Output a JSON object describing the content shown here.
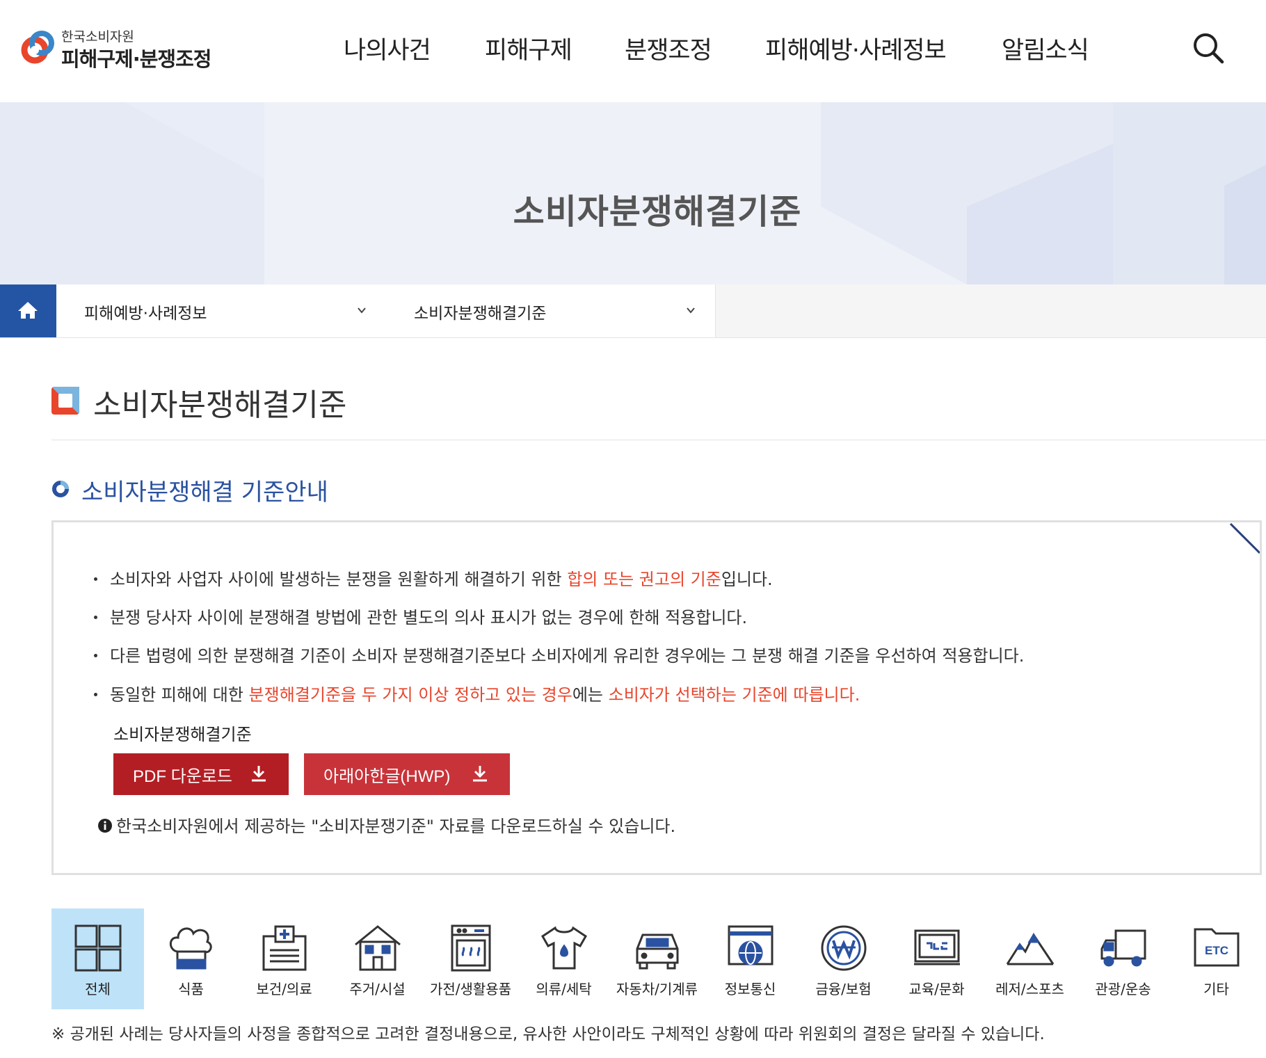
{
  "header": {
    "logo_sub": "한국소비자원",
    "logo_main": "피해구제·분쟁조정",
    "nav": [
      "나의사건",
      "피해구제",
      "분쟁조정",
      "피해예방·사례정보",
      "알림소식"
    ],
    "search_icon": "search-icon"
  },
  "banner": {
    "title": "소비자분쟁해결기준"
  },
  "breadcrumb": {
    "home_icon": "home-icon",
    "level1": "피해예방·사례정보",
    "level2": "소비자분쟁해결기준"
  },
  "page_title": "소비자분쟁해결기준",
  "section_title": "소비자분쟁해결 기준안내",
  "info": {
    "b1_pre": "소비자와 사업자 사이에 발생하는 분쟁을 원활하게 해결하기 위한 ",
    "b1_red": "합의 또는 권고의 기준",
    "b1_post": "입니다.",
    "b2": "분쟁 당사자 사이에 분쟁해결 방법에 관한 별도의 의사 표시가 없는 경우에 한해 적용합니다.",
    "b3": "다른 법령에 의한 분쟁해결 기준이 소비자 분쟁해결기준보다 소비자에게 유리한 경우에는 그 분쟁 해결 기준을 우선하여 적용합니다.",
    "b4_pre": "동일한 피해에 대한 ",
    "b4_red1": "분쟁해결기준을 두 가지 이상 정하고 있는 경우",
    "b4_mid": "에는 ",
    "b4_red2": "소비자가 선택하는 기준에 따릅니다.",
    "download_label": "소비자분쟁해결기준",
    "pdf_button": "PDF 다운로드",
    "hwp_button": "아래아한글(HWP)",
    "note": "한국소비자원에서 제공하는 \"소비자분쟁기준\" 자료를 다운로드하실 수 있습니다."
  },
  "categories": [
    {
      "label": "전체",
      "icon": "grid-icon",
      "active": true
    },
    {
      "label": "식품",
      "icon": "chef-hat-icon"
    },
    {
      "label": "보건/의료",
      "icon": "medical-chart-icon"
    },
    {
      "label": "주거/시설",
      "icon": "house-icon"
    },
    {
      "label": "가전/생활용품",
      "icon": "oven-icon"
    },
    {
      "label": "의류/세탁",
      "icon": "shirt-icon"
    },
    {
      "label": "자동차/기계류",
      "icon": "car-icon"
    },
    {
      "label": "정보통신",
      "icon": "globe-window-icon"
    },
    {
      "label": "금융/보험",
      "icon": "won-coin-icon"
    },
    {
      "label": "교육/문화",
      "icon": "blackboard-icon"
    },
    {
      "label": "레저/스포츠",
      "icon": "mountain-icon"
    },
    {
      "label": "관광/운송",
      "icon": "truck-icon"
    },
    {
      "label": "기타",
      "icon": "etc-folder-icon"
    }
  ],
  "footnote": "※ 공개된 사례는 당사자들의 사정을 종합적으로 고려한 결정내용으로, 유사한 사안이라도 구체적인 상황에 따라 위원회의 결정은 달라질 수 있습니다.",
  "colors": {
    "primary_blue": "#2355a4",
    "accent_red": "#e8452c",
    "button_red": "#b31e24",
    "button_red2": "#c8333a",
    "active_tab": "#bee3f8"
  }
}
